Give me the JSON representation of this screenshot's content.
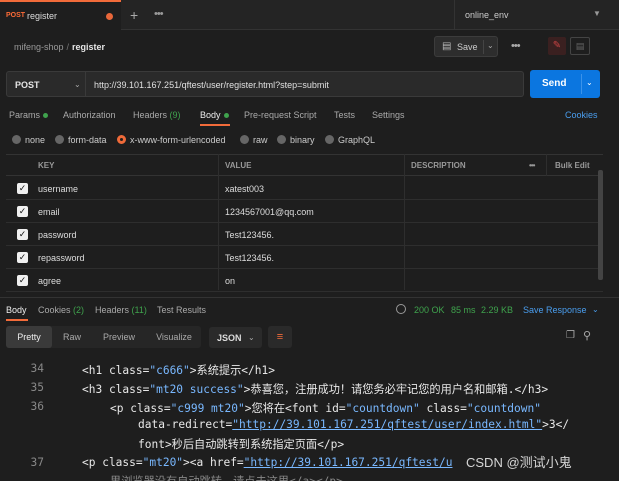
{
  "tabbar": {
    "method": "POST",
    "tab_name": "register",
    "environment": "online_env"
  },
  "breadcrumb": {
    "workspace": "mifeng-shop",
    "separator": "/",
    "request": "register"
  },
  "actions": {
    "save_label": "Save"
  },
  "request": {
    "method": "POST",
    "url": "http://39.101.167.251/qftest/user/register.html?step=submit",
    "send_label": "Send"
  },
  "request_tabs": {
    "params": "Params",
    "authorization": "Authorization",
    "headers": "Headers",
    "headers_count": "(9)",
    "body": "Body",
    "prerequest": "Pre-request Script",
    "tests": "Tests",
    "settings": "Settings",
    "cookies": "Cookies"
  },
  "body_types": [
    "none",
    "form-data",
    "x-www-form-urlencoded",
    "raw",
    "binary",
    "GraphQL"
  ],
  "body_type_selected": "x-www-form-urlencoded",
  "params_table": {
    "headers": {
      "key": "KEY",
      "value": "VALUE",
      "description": "DESCRIPTION",
      "bulk_edit": "Bulk Edit"
    },
    "rows": [
      {
        "key": "username",
        "value": "xatest003"
      },
      {
        "key": "email",
        "value": "1234567001@qq.com"
      },
      {
        "key": "password",
        "value": "Test123456."
      },
      {
        "key": "repassword",
        "value": "Test123456."
      },
      {
        "key": "agree",
        "value": "on"
      }
    ]
  },
  "response_tabs": {
    "body": "Body",
    "cookies": "Cookies",
    "cookies_count": "(2)",
    "headers": "Headers",
    "headers_count": "(11)",
    "test_results": "Test Results"
  },
  "response_status": {
    "code": "200 OK",
    "time": "85 ms",
    "size": "2.29 KB",
    "save_response": "Save Response"
  },
  "view_tabs": [
    "Pretty",
    "Raw",
    "Preview",
    "Visualize"
  ],
  "format": "JSON",
  "code": {
    "line_34": "34",
    "line_35": "35",
    "line_36": "36",
    "line_37": "37",
    "l34_a": "<h1 class=",
    "l34_b": "\"c666\"",
    "l34_c": ">系统提示</h1>",
    "l35_a": "<h3 class=",
    "l35_b": "\"mt20 success\"",
    "l35_c": ">恭喜您，注册成功！请您务必牢记您的用户名和邮箱.</h3>",
    "l36_a": "<p class=",
    "l36_b": "\"c999 mt20\"",
    "l36_c": ">您将在<font id=",
    "l36_d": "\"countdown\"",
    "l36_e": " class=",
    "l36_f": "\"countdown\"",
    "l36w1_a": "data-redirect=",
    "l36w1_b": "\"http://39.101.167.251/qftest/user/index.html\"",
    "l36w1_c": ">3</",
    "l36w2_a": "font>秒后自动跳转到系统指定页面</p>",
    "l37_a": "<p class=",
    "l37_b": "\"mt20\"",
    "l37_c": "><a href=",
    "l37_d": "\"http://39.101.167.251/qftest/u",
    "l37w1": "果浏览器没有自动跳转，请点击这里</a></p>"
  },
  "watermark": "CSDN @测试小鬼"
}
